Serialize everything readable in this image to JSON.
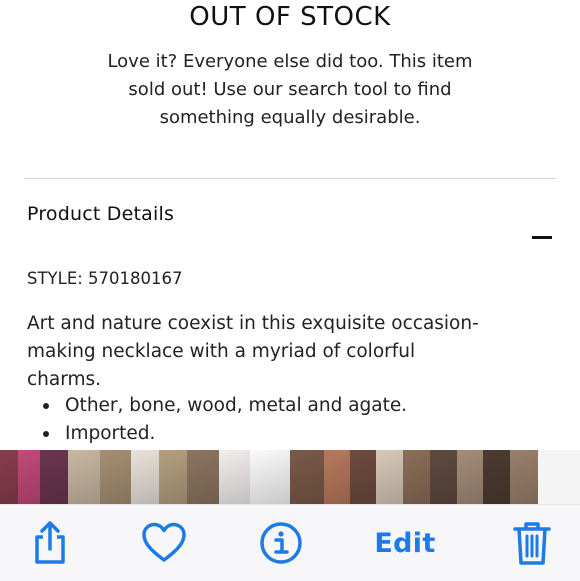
{
  "out_of_stock": {
    "title": "OUT OF STOCK",
    "message_line1": "Love it? Everyone else did too. This item",
    "message_line2": "sold out! Use our search tool to find",
    "message_line3": "something equally desirable."
  },
  "product_details": {
    "heading": "Product Details",
    "collapse_icon": "minus-icon",
    "style": "STYLE: 570180167",
    "description_line1": "Art and nature coexist in this exquisite occasion-",
    "description_line2": "making necklace with a myriad of colorful",
    "description_line3": "charms.",
    "bullets": [
      "Other, bone, wood, metal and agate.",
      "Imported."
    ]
  },
  "thumbnails": [
    {
      "color": "#8a3d4e"
    },
    {
      "color": "#c24a7a"
    },
    {
      "color": "#6b3550"
    },
    {
      "color": "#c9b8a2"
    },
    {
      "color": "#a68f73"
    },
    {
      "color": "#e8e2da"
    },
    {
      "color": "#b59f7f"
    },
    {
      "color": "#8d7560"
    },
    {
      "color": "#f2eeee"
    },
    {
      "color": "#fafafa"
    },
    {
      "color": "#7a5a48"
    },
    {
      "color": "#b7795d"
    },
    {
      "color": "#6e4c3e"
    },
    {
      "color": "#d7c9b9"
    },
    {
      "color": "#8c6e58"
    },
    {
      "color": "#5f4a3f"
    },
    {
      "color": "#a58c78"
    },
    {
      "color": "#4d3b33"
    },
    {
      "color": "#9a806b"
    }
  ],
  "toolbar": {
    "accent": "#1c7be6",
    "share_icon": "share-icon",
    "favorite_icon": "heart-icon",
    "info_icon": "info-icon",
    "edit_label": "Edit",
    "delete_icon": "trash-icon"
  }
}
